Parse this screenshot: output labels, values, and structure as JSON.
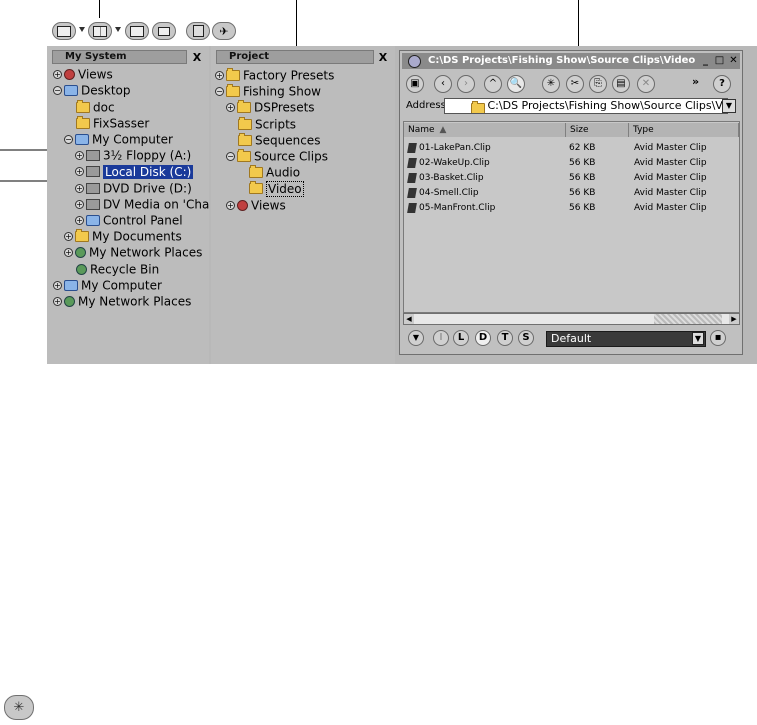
{
  "panels": {
    "my_system": {
      "title": "My System",
      "items": [
        {
          "label": "Views",
          "icon": "views-icon"
        },
        {
          "label": "Desktop",
          "icon": "desktop-icon"
        },
        {
          "label": "doc",
          "icon": "folder-icon"
        },
        {
          "label": "FixSasser",
          "icon": "folder-icon"
        },
        {
          "label": "My Computer",
          "icon": "computer-icon"
        },
        {
          "label": "3½ Floppy (A:)",
          "icon": "floppy-icon"
        },
        {
          "label": "Local Disk (C:)",
          "icon": "disk-icon"
        },
        {
          "label": "DVD Drive (D:)",
          "icon": "dvd-icon"
        },
        {
          "label": "DV Media on 'Cha",
          "icon": "network-drive-icon"
        },
        {
          "label": "Control Panel",
          "icon": "control-panel-icon"
        },
        {
          "label": "My Documents",
          "icon": "documents-icon"
        },
        {
          "label": "My Network Places",
          "icon": "network-icon"
        },
        {
          "label": "Recycle Bin",
          "icon": "recycle-bin-icon"
        },
        {
          "label": "My Computer",
          "icon": "computer-icon"
        },
        {
          "label": "My Network Places",
          "icon": "network-icon"
        }
      ]
    },
    "project": {
      "title": "Project",
      "items": [
        {
          "label": "Factory Presets",
          "icon": "folder-icon"
        },
        {
          "label": "Fishing Show",
          "icon": "folder-icon"
        },
        {
          "label": "DSPresets",
          "icon": "folder-icon"
        },
        {
          "label": "Scripts",
          "icon": "folder-icon"
        },
        {
          "label": "Sequences",
          "icon": "folder-icon"
        },
        {
          "label": "Source Clips",
          "icon": "folder-icon"
        },
        {
          "label": "Audio",
          "icon": "folder-icon"
        },
        {
          "label": "Video",
          "icon": "folder-icon"
        },
        {
          "label": "Views",
          "icon": "views-icon"
        }
      ]
    },
    "close_label": "X"
  },
  "explorer": {
    "title": "C:\\DS Projects\\Fishing Show\\Source Clips\\Video",
    "address_label": "Address",
    "address_value": "C:\\DS Projects\\Fishing Show\\Source Clips\\V",
    "more_label": "»",
    "help_label": "?",
    "columns": [
      "Name",
      "Size",
      "Type"
    ],
    "sort_indicator": "▲",
    "files": [
      {
        "name": "01-LakePan.Clip",
        "size": "62 KB",
        "type": "Avid Master Clip"
      },
      {
        "name": "02-WakeUp.Clip",
        "size": "56 KB",
        "type": "Avid Master Clip"
      },
      {
        "name": "03-Basket.Clip",
        "size": "56 KB",
        "type": "Avid Master Clip"
      },
      {
        "name": "04-Smell.Clip",
        "size": "56 KB",
        "type": "Avid Master Clip"
      },
      {
        "name": "05-ManFront.Clip",
        "size": "56 KB",
        "type": "Avid Master Clip"
      }
    ],
    "filter_buttons": [
      "I",
      "L",
      "D",
      "T",
      "S"
    ],
    "view_preset": "Default"
  },
  "colors": {
    "panel_bg": "#bcbcbc",
    "selection": "#1a3a9a",
    "folder": "#f2c94c"
  }
}
